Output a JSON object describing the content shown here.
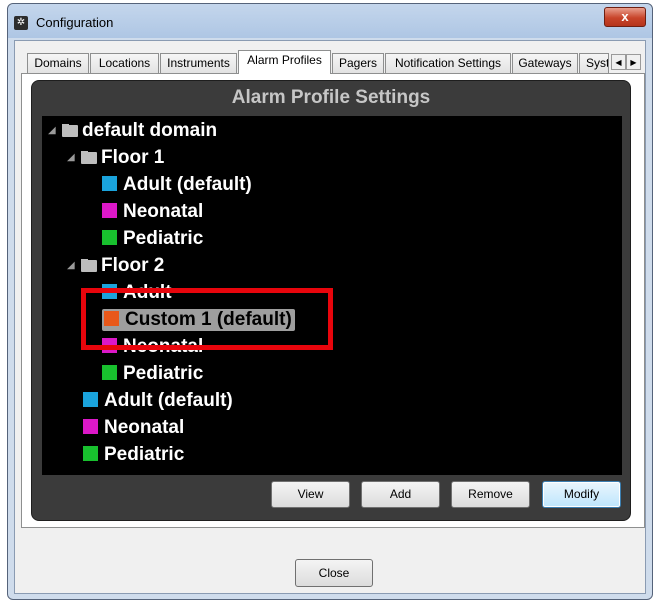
{
  "window": {
    "title": "Configuration",
    "close_glyph": "x"
  },
  "tabs": [
    {
      "label": "Domains"
    },
    {
      "label": "Locations"
    },
    {
      "label": "Instruments"
    },
    {
      "label": "Alarm Profiles",
      "active": true
    },
    {
      "label": "Pagers"
    },
    {
      "label": "Notification Settings"
    },
    {
      "label": "Gateways"
    },
    {
      "label": "Syst"
    }
  ],
  "panel": {
    "title": "Alarm Profile Settings"
  },
  "tree": {
    "root": "default domain",
    "floor1": {
      "label": "Floor 1",
      "profiles": [
        {
          "label": "Adult (default)",
          "color": "#1aa3dc"
        },
        {
          "label": "Neonatal",
          "color": "#dc18c8"
        },
        {
          "label": "Pediatric",
          "color": "#18c02e"
        }
      ]
    },
    "floor2": {
      "label": "Floor 2",
      "profiles": [
        {
          "label": "Adult",
          "color": "#1aa3dc"
        },
        {
          "label": "Custom 1 (default)",
          "color": "#e8581a",
          "selected": true
        },
        {
          "label": "Neonatal",
          "color": "#dc18c8"
        },
        {
          "label": "Pediatric",
          "color": "#18c02e"
        }
      ]
    },
    "domain_profiles": [
      {
        "label": "Adult (default)",
        "color": "#1aa3dc"
      },
      {
        "label": "Neonatal",
        "color": "#dc18c8"
      },
      {
        "label": "Pediatric",
        "color": "#18c02e"
      }
    ]
  },
  "buttons": {
    "view": "View",
    "add": "Add",
    "remove": "Remove",
    "modify": "Modify",
    "close": "Close"
  },
  "colors": {
    "highlight": "#e8050c",
    "panel_bg": "#3b3b3b",
    "tree_bg": "#000000"
  }
}
